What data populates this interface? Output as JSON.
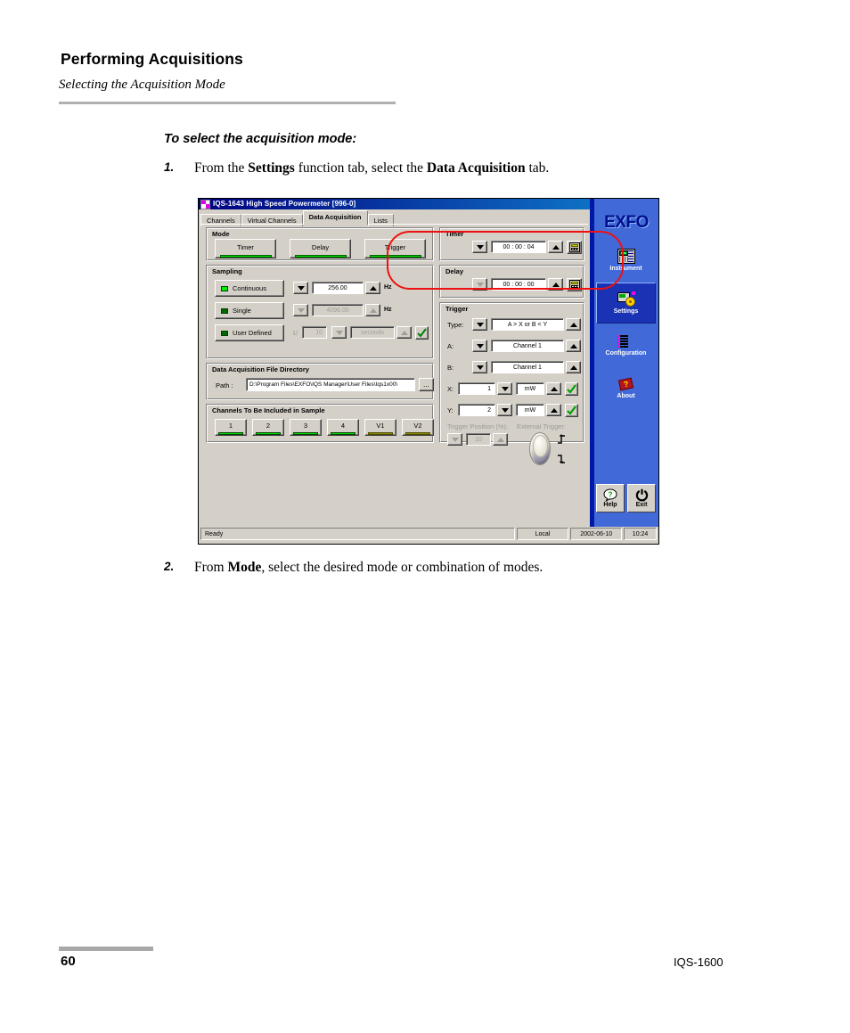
{
  "document": {
    "title": "Performing Acquisitions",
    "subtitle": "Selecting the Acquisition Mode",
    "procedure_title": "To select the acquisition mode:",
    "steps": [
      {
        "num": "1.",
        "prefix": "From the ",
        "bold1": "Settings",
        "mid": " function tab, select the ",
        "bold2": "Data Acquisition",
        "suffix": " tab."
      },
      {
        "num": "2.",
        "prefix": "From ",
        "bold1": "Mode",
        "mid": ", select the desired mode or combination of modes.",
        "bold2": "",
        "suffix": ""
      }
    ],
    "page_number": "60",
    "footer_right": "IQS-1600"
  },
  "app": {
    "window_title": "IQS-1643 High Speed Powermeter [996-0]",
    "window_buttons": {
      "minimize": "_",
      "maximize": "❐",
      "close": "✕"
    },
    "tabs": [
      {
        "label": "Channels",
        "active": false
      },
      {
        "label": "Virtual Channels",
        "active": false
      },
      {
        "label": "Data Acquisition",
        "active": true
      },
      {
        "label": "Lists",
        "active": false
      }
    ],
    "mode": {
      "group_label": "Mode",
      "buttons": [
        {
          "label": "Timer"
        },
        {
          "label": "Delay"
        },
        {
          "label": "Trigger"
        }
      ]
    },
    "sampling": {
      "group_label": "Sampling",
      "rows": [
        {
          "label": "Continuous",
          "state": "on",
          "value": "256.00",
          "unit": "Hz",
          "enabled": true
        },
        {
          "label": "Single",
          "state": "off",
          "value": "4096.00",
          "unit": "Hz",
          "enabled": false
        },
        {
          "label": "User Defined",
          "state": "off",
          "prefix": "1/",
          "value": "10",
          "unit": "seconds",
          "enabled": false
        }
      ]
    },
    "file_directory": {
      "group_label": "Data Acquisition File Directory",
      "path_label": "Path :",
      "path_value": "D:\\Program Files\\EXFO\\IQS Manager\\User Files\\Iqs1x00\\",
      "browse_label": "..."
    },
    "channels": {
      "group_label": "Channels To Be Included in Sample",
      "buttons": [
        {
          "label": "1",
          "bar": "green"
        },
        {
          "label": "2",
          "bar": "green"
        },
        {
          "label": "3",
          "bar": "green"
        },
        {
          "label": "4",
          "bar": "green"
        },
        {
          "label": "V1",
          "bar": "olive"
        },
        {
          "label": "V2",
          "bar": "olive"
        }
      ]
    },
    "timer": {
      "group_label": "Timer",
      "value": "00 : 00 : 04",
      "keypad_icon": "calculator-icon"
    },
    "delay": {
      "group_label": "Delay",
      "value": "00 : 00 : 00",
      "keypad_icon": "calculator-icon"
    },
    "trigger": {
      "group_label": "Trigger",
      "type_label": "Type:",
      "type_value": "A > X or B < Y",
      "a_label": "A:",
      "a_value": "Channel 1",
      "b_label": "B:",
      "b_value": "Channel 1",
      "x_label": "X:",
      "x_value": "1",
      "x_unit": "mW",
      "y_label": "Y:",
      "y_value": "2",
      "y_unit": "mW",
      "position_label": "Trigger Position (%):",
      "position_value": "10",
      "external_label": "External Trigger:"
    },
    "sidebar": {
      "logo": "EXFO",
      "items": [
        {
          "label": "Instrument",
          "icon": "instrument-icon",
          "selected": false
        },
        {
          "label": "Settings",
          "icon": "settings-gear-icon",
          "selected": true
        },
        {
          "label": "Configuration",
          "icon": "configuration-icon",
          "selected": false
        },
        {
          "label": "About",
          "icon": "about-book-icon",
          "selected": false
        }
      ],
      "help_label": "Help",
      "exit_label": "Exit"
    },
    "statusbar": {
      "status": "Ready",
      "location": "Local",
      "date": "2002-06-10",
      "time": "10:24"
    },
    "colors": {
      "titlebar_start": "#000080",
      "titlebar_end": "#1084d0",
      "face": "#d4d0c8",
      "sidebar": "#4169d8",
      "sidebar_selected": "#1a32b4",
      "led_on": "#00ee00",
      "led_off": "#006600",
      "bar_green": "#00e000",
      "bar_olive": "#8a8a00",
      "annotation_red": "#ee1111"
    }
  }
}
